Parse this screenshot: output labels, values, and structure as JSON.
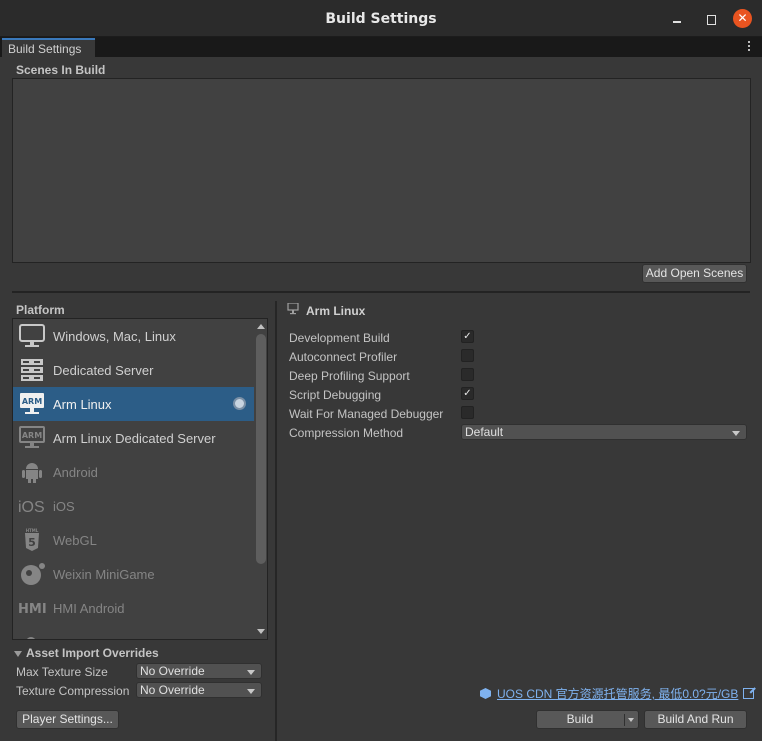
{
  "window": {
    "title": "Build Settings",
    "controls": {
      "minimize": "minimize",
      "maximize": "maximize",
      "close": "✕"
    }
  },
  "tab": {
    "label": "Build Settings"
  },
  "scenes": {
    "label": "Scenes In Build",
    "items": [],
    "add_open_scenes_label": "Add Open Scenes"
  },
  "platform": {
    "label": "Platform",
    "items": [
      {
        "label": "Windows, Mac, Linux",
        "icon": "monitor-icon",
        "state": "enabled"
      },
      {
        "label": "Dedicated Server",
        "icon": "server-icon",
        "state": "enabled"
      },
      {
        "label": "Arm Linux",
        "icon": "arm-monitor-icon",
        "state": "selected",
        "badge": "unity-active-icon"
      },
      {
        "label": "Arm Linux Dedicated Server",
        "icon": "arm-monitor-icon",
        "state": "enabled"
      },
      {
        "label": "Android",
        "icon": "android-icon",
        "state": "disabled"
      },
      {
        "label": "iOS",
        "icon": "ios-icon",
        "icon_text": "iOS",
        "state": "disabled"
      },
      {
        "label": "WebGL",
        "icon": "html5-icon",
        "state": "disabled"
      },
      {
        "label": "Weixin MiniGame",
        "icon": "weixin-minigame-icon",
        "state": "disabled"
      },
      {
        "label": "HMI Android",
        "icon": "hmi-icon",
        "icon_text": "HMI",
        "state": "disabled"
      }
    ]
  },
  "asset_import": {
    "header": "Asset Import Overrides",
    "max_texture_size": {
      "label": "Max Texture Size",
      "value": "No Override"
    },
    "texture_compression": {
      "label": "Texture Compression",
      "value": "No Override"
    }
  },
  "player_settings_label": "Player Settings...",
  "selected_platform": {
    "title": "Arm Linux",
    "options": [
      {
        "label": "Development Build",
        "checked": true
      },
      {
        "label": "Autoconnect Profiler",
        "checked": false
      },
      {
        "label": "Deep Profiling Support",
        "checked": false
      },
      {
        "label": "Script Debugging",
        "checked": true
      },
      {
        "label": "Wait For Managed Debugger",
        "checked": false
      }
    ],
    "compression": {
      "label": "Compression Method",
      "value": "Default"
    }
  },
  "cdn_link": {
    "text": "UOS CDN 官方资源托管服务, 最低0.0?元/GB"
  },
  "buttons": {
    "build": "Build",
    "build_and_run": "Build And Run"
  },
  "check_glyph": "✓"
}
